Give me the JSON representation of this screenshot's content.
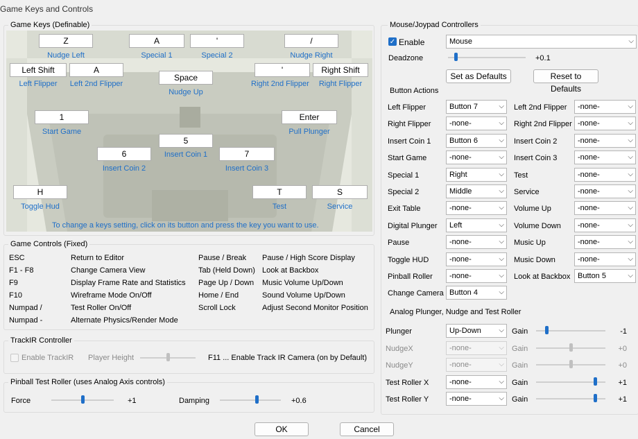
{
  "window": {
    "title": "Game Keys and Controls"
  },
  "game_keys": {
    "legend": "Game Keys (Definable)",
    "hint": "To change a keys setting, click on its button and press the key you want to use.",
    "keys": [
      {
        "key": "Z",
        "label": "Nudge Left"
      },
      {
        "key": "A",
        "label": "Special 1"
      },
      {
        "key": "'",
        "label": "Special 2"
      },
      {
        "key": "/",
        "label": "Nudge Right"
      },
      {
        "key": "Left Shift",
        "label": "Left Flipper"
      },
      {
        "key": "A",
        "label": "Left 2nd Flipper"
      },
      {
        "key": "Space",
        "label": "Nudge Up"
      },
      {
        "key": "'",
        "label": "Right 2nd Flipper"
      },
      {
        "key": "Right Shift",
        "label": "Right Flipper"
      },
      {
        "key": "1",
        "label": "Start Game"
      },
      {
        "key": "5",
        "label": "Insert Coin 1"
      },
      {
        "key": "Enter",
        "label": "Pull Plunger"
      },
      {
        "key": "6",
        "label": "Insert Coin 2"
      },
      {
        "key": "7",
        "label": "Insert Coin 3"
      },
      {
        "key": "H",
        "label": "Toggle Hud"
      },
      {
        "key": "T",
        "label": "Test"
      },
      {
        "key": "S",
        "label": "Service"
      }
    ]
  },
  "game_controls": {
    "legend": "Game Controls (Fixed)",
    "left": [
      {
        "key": "ESC",
        "action": "Return to Editor"
      },
      {
        "key": "F1 - F8",
        "action": "Change Camera View"
      },
      {
        "key": "F9",
        "action": "Display Frame Rate and Statistics"
      },
      {
        "key": "F10",
        "action": "Wireframe Mode On/Off"
      },
      {
        "key": "Numpad /",
        "action": "Test Roller On/Off"
      },
      {
        "key": "Numpad -",
        "action": "Alternate Physics/Render Mode"
      }
    ],
    "right": [
      {
        "key": "Pause / Break",
        "action": "Pause / High Score Display"
      },
      {
        "key": "Tab (Held Down)",
        "action": "Look at Backbox"
      },
      {
        "key": "Page Up / Down",
        "action": "Music Volume Up/Down"
      },
      {
        "key": "Home / End",
        "action": "Sound Volume Up/Down"
      },
      {
        "key": "Scroll Lock",
        "action": "Adjust Second Monitor Position"
      }
    ]
  },
  "trackir": {
    "legend": "TrackIR Controller",
    "enable_label": "Enable TrackIR",
    "enabled": false,
    "player_height_label": "Player Height",
    "player_height_level": 0.5,
    "f11_text": "F11 ... Enable Track IR Camera (on by Default)"
  },
  "test_roller": {
    "legend": "Pinball Test Roller (uses Analog Axis controls)",
    "force_label": "Force",
    "force_value": "+1",
    "force_level": 0.5,
    "damping_label": "Damping",
    "damping_value": "+0.6",
    "damping_level": 0.6
  },
  "mouse": {
    "legend": "Mouse/Joypad Controllers",
    "enable_label": "Enable",
    "enabled": true,
    "device": "Mouse",
    "deadzone_label": "Deadzone",
    "deadzone_value": "+0.1",
    "deadzone_level": 0.1,
    "set_defaults": "Set as Defaults",
    "reset_defaults": "Reset to Defaults"
  },
  "button_actions": {
    "legend": "Button Actions",
    "rows": [
      {
        "l1": "Left Flipper",
        "v1": "Button 7",
        "l2": "Left 2nd Flipper",
        "v2": "-none-"
      },
      {
        "l1": "Right Flipper",
        "v1": "-none-",
        "l2": "Right 2nd Flipper",
        "v2": "-none-"
      },
      {
        "l1": "Insert Coin 1",
        "v1": "Button 6",
        "l2": "Insert Coin 2",
        "v2": "-none-"
      },
      {
        "l1": "Start Game",
        "v1": "-none-",
        "l2": "Insert Coin 3",
        "v2": "-none-"
      },
      {
        "l1": "Special 1",
        "v1": "Right",
        "l2": "Test",
        "v2": "-none-"
      },
      {
        "l1": "Special 2",
        "v1": "Middle",
        "l2": "Service",
        "v2": "-none-"
      },
      {
        "l1": "Exit Table",
        "v1": "-none-",
        "l2": "Volume Up",
        "v2": "-none-"
      },
      {
        "l1": "Digital Plunger",
        "v1": "Left",
        "l2": "Volume Down",
        "v2": "-none-"
      },
      {
        "l1": "Pause",
        "v1": "-none-",
        "l2": "Music Up",
        "v2": "-none-"
      },
      {
        "l1": "Toggle HUD",
        "v1": "-none-",
        "l2": "Music Down",
        "v2": "-none-"
      },
      {
        "l1": "Pinball Roller",
        "v1": "-none-",
        "l2": "Look at Backbox",
        "v2": "Button 5"
      },
      {
        "l1": "Change Camera",
        "v1": "Button 4"
      }
    ]
  },
  "analog": {
    "legend": "Analog Plunger, Nudge and Test Roller",
    "gain_label": "Gain",
    "rows": [
      {
        "label": "Plunger",
        "value": "Up-Down",
        "gain": "-1",
        "level": 0.15,
        "disabled": false
      },
      {
        "label": "NudgeX",
        "value": "-none-",
        "gain": "+0",
        "level": 0.5,
        "disabled": true
      },
      {
        "label": "NudgeY",
        "value": "-none-",
        "gain": "+0",
        "level": 0.5,
        "disabled": true
      },
      {
        "label": "Test Roller X",
        "value": "-none-",
        "gain": "+1",
        "level": 0.85,
        "disabled": false
      },
      {
        "label": "Test Roller Y",
        "value": "-none-",
        "gain": "+1",
        "level": 0.85,
        "disabled": false
      }
    ]
  },
  "footer": {
    "ok": "OK",
    "cancel": "Cancel"
  },
  "colors": {
    "accent": "#1f6fc8",
    "key_label": "#1f6fc8"
  }
}
